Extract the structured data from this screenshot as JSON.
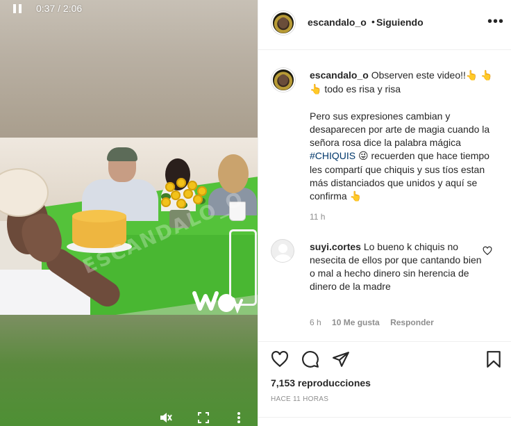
{
  "video": {
    "watermark": "ESCANDALO_O",
    "logo": "wow",
    "controls": {
      "time": "0:37 / 2:06",
      "pause_icon": "pause-icon",
      "mute_icon": "muted-speaker-icon",
      "fullscreen_icon": "fullscreen-icon",
      "more_icon": "vertical-dots-icon"
    }
  },
  "header": {
    "username": "escandalo_o",
    "separator": "•",
    "follow_status": "Siguiendo",
    "more": "•••"
  },
  "caption": {
    "username": "escandalo_o",
    "line1": " Observen este video!!",
    "line1b": " todo es risa y risa",
    "para_before_tag": "Pero sus expresiones cambian y desaparecen por arte de magia cuando la señora rosa dice la palabra mágica ",
    "hashtag": "#CHIQUIS",
    "para_after_tag": " recuerden que hace tiempo les compartí que chiquis y sus tíos estan más distanciados que unidos y aquí se confirma ",
    "hand_emoji": "👆",
    "tongue_emoji": "😜",
    "time": "11 h"
  },
  "comment": {
    "username": "suyi.cortes",
    "text": " Lo bueno k chiquis no nesecita de ellos por que cantando bien o mal a hecho dinero sin herencia de dinero de la madre",
    "time": "6 h",
    "likes": "10 Me gusta",
    "reply": "Responder"
  },
  "actions": {
    "views": "7,153 reproducciones",
    "posted": "HACE 11 HORAS"
  },
  "colors": {
    "text": "#262626",
    "muted": "#8e8e8e",
    "hashtag": "#00376b",
    "border": "#efefef"
  }
}
